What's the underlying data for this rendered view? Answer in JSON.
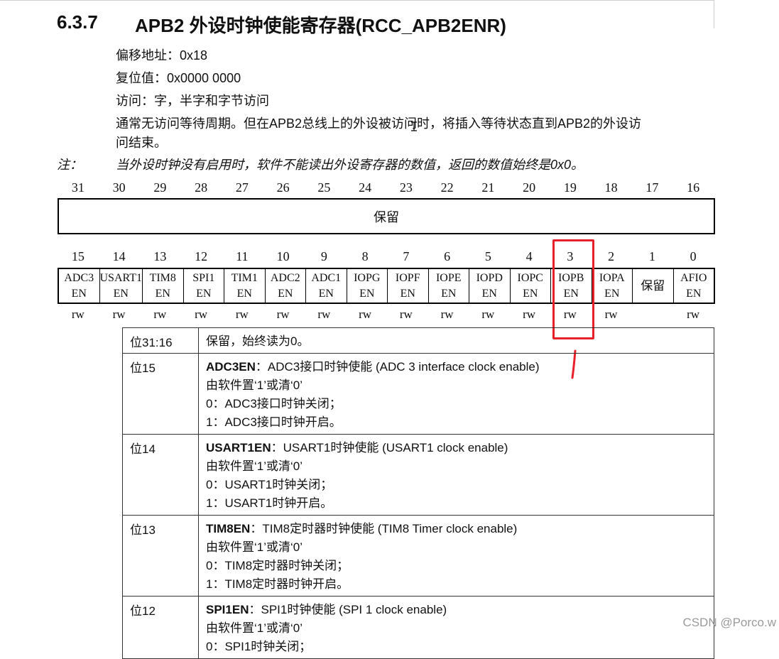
{
  "heading": {
    "number": "6.3.7",
    "title": "APB2 外设时钟使能寄存器(RCC_APB2ENR)"
  },
  "meta": {
    "offset": "偏移地址：0x18",
    "reset": "复位值：0x0000 0000",
    "access": "访问：字，半字和字节访问",
    "wait_line1": "通常无访问等待周期。但在APB2总线上的外设被访问时，将插入等待状态直到APB2的外设访",
    "wait_line2": "问结束。"
  },
  "note": {
    "label": "注：",
    "text": "当外设时钟没有启用时，软件不能读出外设寄存器的数值，返回的数值始终是0x0。"
  },
  "register_high": {
    "bit_numbers": [
      "31",
      "30",
      "29",
      "28",
      "27",
      "26",
      "25",
      "24",
      "23",
      "22",
      "21",
      "20",
      "19",
      "18",
      "17",
      "16"
    ],
    "reserved_label": "保留"
  },
  "register_low": {
    "bit_numbers": [
      "15",
      "14",
      "13",
      "12",
      "11",
      "10",
      "9",
      "8",
      "7",
      "6",
      "5",
      "4",
      "3",
      "2",
      "1",
      "0"
    ],
    "fields": [
      {
        "name": "ADC3\nEN",
        "access": "rw"
      },
      {
        "name": "USART1\nEN",
        "access": "rw"
      },
      {
        "name": "TIM8\nEN",
        "access": "rw"
      },
      {
        "name": "SPI1\nEN",
        "access": "rw"
      },
      {
        "name": "TIM1\nEN",
        "access": "rw"
      },
      {
        "name": "ADC2\nEN",
        "access": "rw"
      },
      {
        "name": "ADC1\nEN",
        "access": "rw"
      },
      {
        "name": "IOPG\nEN",
        "access": "rw"
      },
      {
        "name": "IOPF\nEN",
        "access": "rw"
      },
      {
        "name": "IOPE\nEN",
        "access": "rw"
      },
      {
        "name": "IOPD\nEN",
        "access": "rw"
      },
      {
        "name": "IOPC\nEN",
        "access": "rw"
      },
      {
        "name": "IOPB\nEN",
        "access": "rw"
      },
      {
        "name": "IOPA\nEN",
        "access": "rw"
      },
      {
        "name": "保留",
        "access": ""
      },
      {
        "name": "AFIO\nEN",
        "access": "rw"
      }
    ]
  },
  "descriptions": [
    {
      "bit": "位31:16",
      "title": "",
      "title_rest": "保留，始终读为0。",
      "lines": []
    },
    {
      "bit": "位15",
      "title": "ADC3EN",
      "title_rest": "：ADC3接口时钟使能 (ADC 3 interface clock enable)",
      "lines": [
        "由软件置‘1’或清‘0’",
        "0：ADC3接口时钟关闭；",
        "1：ADC3接口时钟开启。"
      ]
    },
    {
      "bit": "位14",
      "title": "USART1EN",
      "title_rest": "：USART1时钟使能 (USART1 clock enable)",
      "lines": [
        "由软件置‘1’或清‘0’",
        "0：USART1时钟关闭；",
        "1：USART1时钟开启。"
      ]
    },
    {
      "bit": "位13",
      "title": "TIM8EN",
      "title_rest": "：TIM8定时器时钟使能 (TIM8 Timer clock enable)",
      "lines": [
        "由软件置‘1’或清‘0’",
        "0：TIM8定时器时钟关闭；",
        "1：TIM8定时器时钟开启。"
      ]
    },
    {
      "bit": "位12",
      "title": "SPI1EN",
      "title_rest": "：SPI1时钟使能 (SPI 1 clock enable)",
      "lines": [
        "由软件置‘1’或清‘0’",
        "0：SPI1时钟关闭；"
      ]
    }
  ],
  "annotation": {
    "color": "#e8202a",
    "highlighted_bit": "3"
  },
  "watermark": "CSDN @Porco.w"
}
